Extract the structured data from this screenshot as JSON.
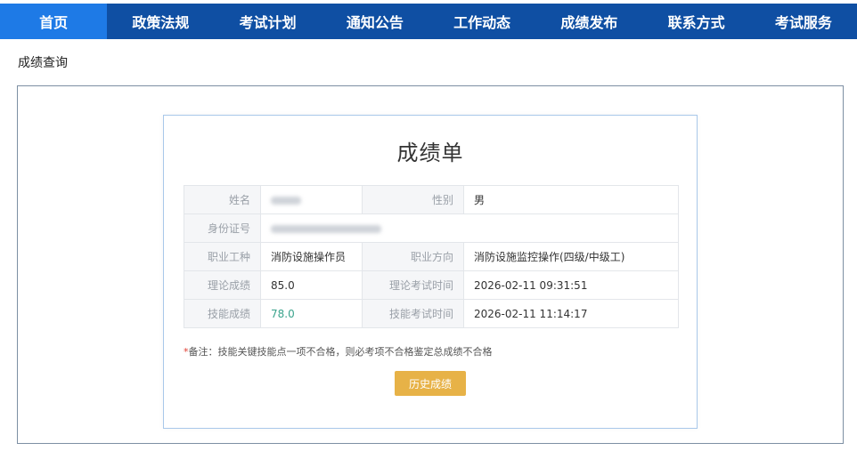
{
  "nav": {
    "items": [
      {
        "label": "首页",
        "active": true
      },
      {
        "label": "政策法规",
        "active": false
      },
      {
        "label": "考试计划",
        "active": false
      },
      {
        "label": "通知公告",
        "active": false
      },
      {
        "label": "工作动态",
        "active": false
      },
      {
        "label": "成绩发布",
        "active": false
      },
      {
        "label": "联系方式",
        "active": false
      },
      {
        "label": "考试服务",
        "active": false
      }
    ]
  },
  "section": {
    "title": "成绩查询"
  },
  "card": {
    "title": "成绩单",
    "rows": {
      "name_label": "姓名",
      "name_value": "",
      "gender_label": "性别",
      "gender_value": "男",
      "id_label": "身份证号",
      "id_value": "",
      "occupation_label": "职业工种",
      "occupation_value": "消防设施操作员",
      "direction_label": "职业方向",
      "direction_value": "消防设施监控操作(四级/中级工)",
      "theory_label": "理论成绩",
      "theory_value": "85.0",
      "theory_time_label": "理论考试时间",
      "theory_time_value": "2026-02-11 09:31:51",
      "skill_label": "技能成绩",
      "skill_value": "78.0",
      "skill_time_label": "技能考试时间",
      "skill_time_value": "2026-02-11 11:14:17"
    },
    "note_star": "*",
    "note_text": "备注：技能关键技能点一项不合格，则必考项不合格鉴定总成绩不合格",
    "history_button": "历史成绩"
  },
  "colors": {
    "nav_bg": "#0f4fa3",
    "nav_active": "#1e7ae6",
    "button": "#e7b247",
    "skill_value": "#3aa38c"
  }
}
